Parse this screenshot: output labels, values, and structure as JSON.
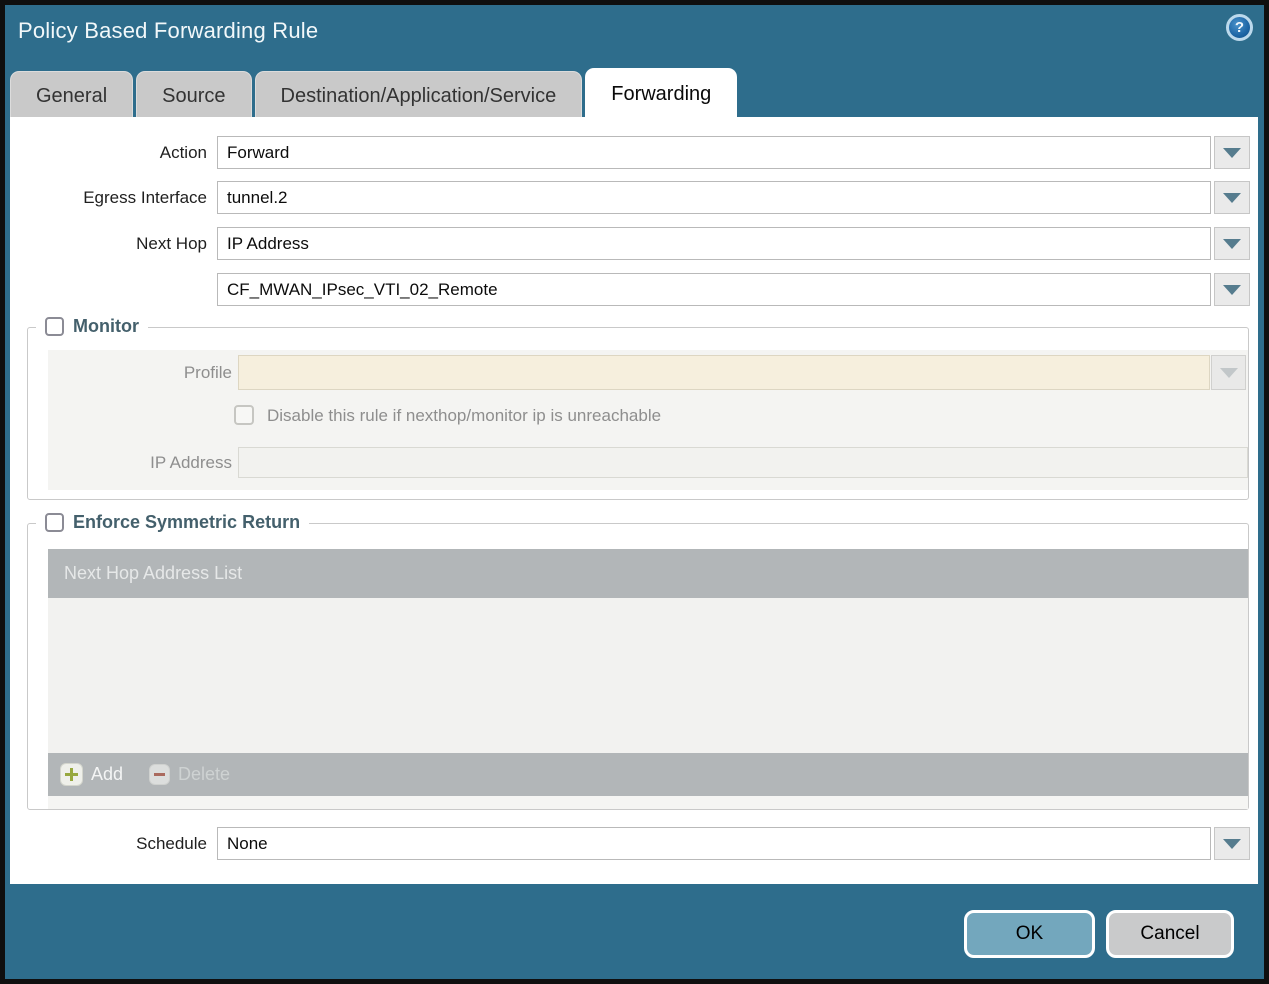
{
  "window": {
    "title": "Policy Based Forwarding Rule"
  },
  "help_icon": {
    "glyph": "?"
  },
  "tabs": [
    {
      "label": "General",
      "active": false
    },
    {
      "label": "Source",
      "active": false
    },
    {
      "label": "Destination/Application/Service",
      "active": false
    },
    {
      "label": "Forwarding",
      "active": true
    }
  ],
  "form": {
    "action": {
      "label": "Action",
      "value": "Forward"
    },
    "egress_interface": {
      "label": "Egress Interface",
      "value": "tunnel.2"
    },
    "next_hop_type": {
      "label": "Next Hop",
      "value": "IP Address"
    },
    "next_hop_address": {
      "value": "CF_MWAN_IPsec_VTI_02_Remote"
    },
    "schedule": {
      "label": "Schedule",
      "value": "None"
    }
  },
  "monitor": {
    "title": "Monitor",
    "checked": false,
    "profile": {
      "label": "Profile",
      "value": ""
    },
    "disable_rule": {
      "label": "Disable this rule if nexthop/monitor ip is unreachable",
      "checked": false
    },
    "ip_address": {
      "label": "IP Address",
      "value": ""
    }
  },
  "enforce_symmetric_return": {
    "title": "Enforce Symmetric Return",
    "checked": false,
    "list": {
      "header": "Next Hop Address List",
      "rows": []
    },
    "toolbar": {
      "add_label": "Add",
      "delete_label": "Delete",
      "delete_enabled": false
    }
  },
  "buttons": {
    "ok": "OK",
    "cancel": "Cancel"
  },
  "colors": {
    "titlebar": "#2e6d8c",
    "ok_button": "#73a7bd",
    "cancel_button": "#c9cacb",
    "section_title": "#44606c",
    "grid_chrome": "#b2b6b8",
    "disabled_field": "#f6efdd",
    "add_icon_green": "#97a83e",
    "delete_icon_red": "#aa6a5e"
  }
}
